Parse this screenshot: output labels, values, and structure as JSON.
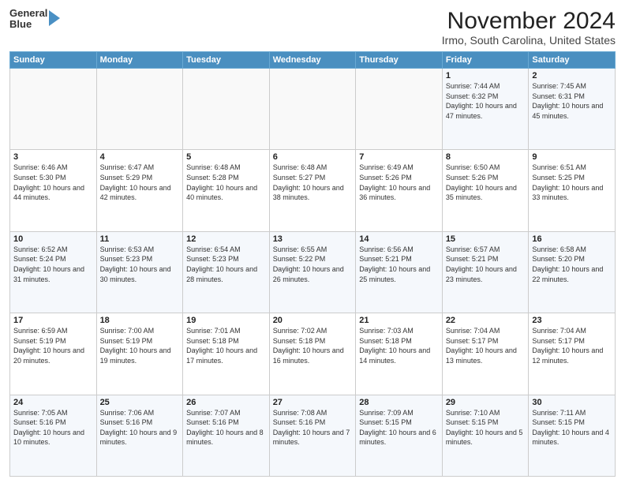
{
  "logo": {
    "line1": "General",
    "line2": "Blue"
  },
  "title": "November 2024",
  "subtitle": "Irmo, South Carolina, United States",
  "weekdays": [
    "Sunday",
    "Monday",
    "Tuesday",
    "Wednesday",
    "Thursday",
    "Friday",
    "Saturday"
  ],
  "weeks": [
    [
      {
        "day": "",
        "info": ""
      },
      {
        "day": "",
        "info": ""
      },
      {
        "day": "",
        "info": ""
      },
      {
        "day": "",
        "info": ""
      },
      {
        "day": "",
        "info": ""
      },
      {
        "day": "1",
        "info": "Sunrise: 7:44 AM\nSunset: 6:32 PM\nDaylight: 10 hours and 47 minutes."
      },
      {
        "day": "2",
        "info": "Sunrise: 7:45 AM\nSunset: 6:31 PM\nDaylight: 10 hours and 45 minutes."
      }
    ],
    [
      {
        "day": "3",
        "info": "Sunrise: 6:46 AM\nSunset: 5:30 PM\nDaylight: 10 hours and 44 minutes."
      },
      {
        "day": "4",
        "info": "Sunrise: 6:47 AM\nSunset: 5:29 PM\nDaylight: 10 hours and 42 minutes."
      },
      {
        "day": "5",
        "info": "Sunrise: 6:48 AM\nSunset: 5:28 PM\nDaylight: 10 hours and 40 minutes."
      },
      {
        "day": "6",
        "info": "Sunrise: 6:48 AM\nSunset: 5:27 PM\nDaylight: 10 hours and 38 minutes."
      },
      {
        "day": "7",
        "info": "Sunrise: 6:49 AM\nSunset: 5:26 PM\nDaylight: 10 hours and 36 minutes."
      },
      {
        "day": "8",
        "info": "Sunrise: 6:50 AM\nSunset: 5:26 PM\nDaylight: 10 hours and 35 minutes."
      },
      {
        "day": "9",
        "info": "Sunrise: 6:51 AM\nSunset: 5:25 PM\nDaylight: 10 hours and 33 minutes."
      }
    ],
    [
      {
        "day": "10",
        "info": "Sunrise: 6:52 AM\nSunset: 5:24 PM\nDaylight: 10 hours and 31 minutes."
      },
      {
        "day": "11",
        "info": "Sunrise: 6:53 AM\nSunset: 5:23 PM\nDaylight: 10 hours and 30 minutes."
      },
      {
        "day": "12",
        "info": "Sunrise: 6:54 AM\nSunset: 5:23 PM\nDaylight: 10 hours and 28 minutes."
      },
      {
        "day": "13",
        "info": "Sunrise: 6:55 AM\nSunset: 5:22 PM\nDaylight: 10 hours and 26 minutes."
      },
      {
        "day": "14",
        "info": "Sunrise: 6:56 AM\nSunset: 5:21 PM\nDaylight: 10 hours and 25 minutes."
      },
      {
        "day": "15",
        "info": "Sunrise: 6:57 AM\nSunset: 5:21 PM\nDaylight: 10 hours and 23 minutes."
      },
      {
        "day": "16",
        "info": "Sunrise: 6:58 AM\nSunset: 5:20 PM\nDaylight: 10 hours and 22 minutes."
      }
    ],
    [
      {
        "day": "17",
        "info": "Sunrise: 6:59 AM\nSunset: 5:19 PM\nDaylight: 10 hours and 20 minutes."
      },
      {
        "day": "18",
        "info": "Sunrise: 7:00 AM\nSunset: 5:19 PM\nDaylight: 10 hours and 19 minutes."
      },
      {
        "day": "19",
        "info": "Sunrise: 7:01 AM\nSunset: 5:18 PM\nDaylight: 10 hours and 17 minutes."
      },
      {
        "day": "20",
        "info": "Sunrise: 7:02 AM\nSunset: 5:18 PM\nDaylight: 10 hours and 16 minutes."
      },
      {
        "day": "21",
        "info": "Sunrise: 7:03 AM\nSunset: 5:18 PM\nDaylight: 10 hours and 14 minutes."
      },
      {
        "day": "22",
        "info": "Sunrise: 7:04 AM\nSunset: 5:17 PM\nDaylight: 10 hours and 13 minutes."
      },
      {
        "day": "23",
        "info": "Sunrise: 7:04 AM\nSunset: 5:17 PM\nDaylight: 10 hours and 12 minutes."
      }
    ],
    [
      {
        "day": "24",
        "info": "Sunrise: 7:05 AM\nSunset: 5:16 PM\nDaylight: 10 hours and 10 minutes."
      },
      {
        "day": "25",
        "info": "Sunrise: 7:06 AM\nSunset: 5:16 PM\nDaylight: 10 hours and 9 minutes."
      },
      {
        "day": "26",
        "info": "Sunrise: 7:07 AM\nSunset: 5:16 PM\nDaylight: 10 hours and 8 minutes."
      },
      {
        "day": "27",
        "info": "Sunrise: 7:08 AM\nSunset: 5:16 PM\nDaylight: 10 hours and 7 minutes."
      },
      {
        "day": "28",
        "info": "Sunrise: 7:09 AM\nSunset: 5:15 PM\nDaylight: 10 hours and 6 minutes."
      },
      {
        "day": "29",
        "info": "Sunrise: 7:10 AM\nSunset: 5:15 PM\nDaylight: 10 hours and 5 minutes."
      },
      {
        "day": "30",
        "info": "Sunrise: 7:11 AM\nSunset: 5:15 PM\nDaylight: 10 hours and 4 minutes."
      }
    ]
  ]
}
